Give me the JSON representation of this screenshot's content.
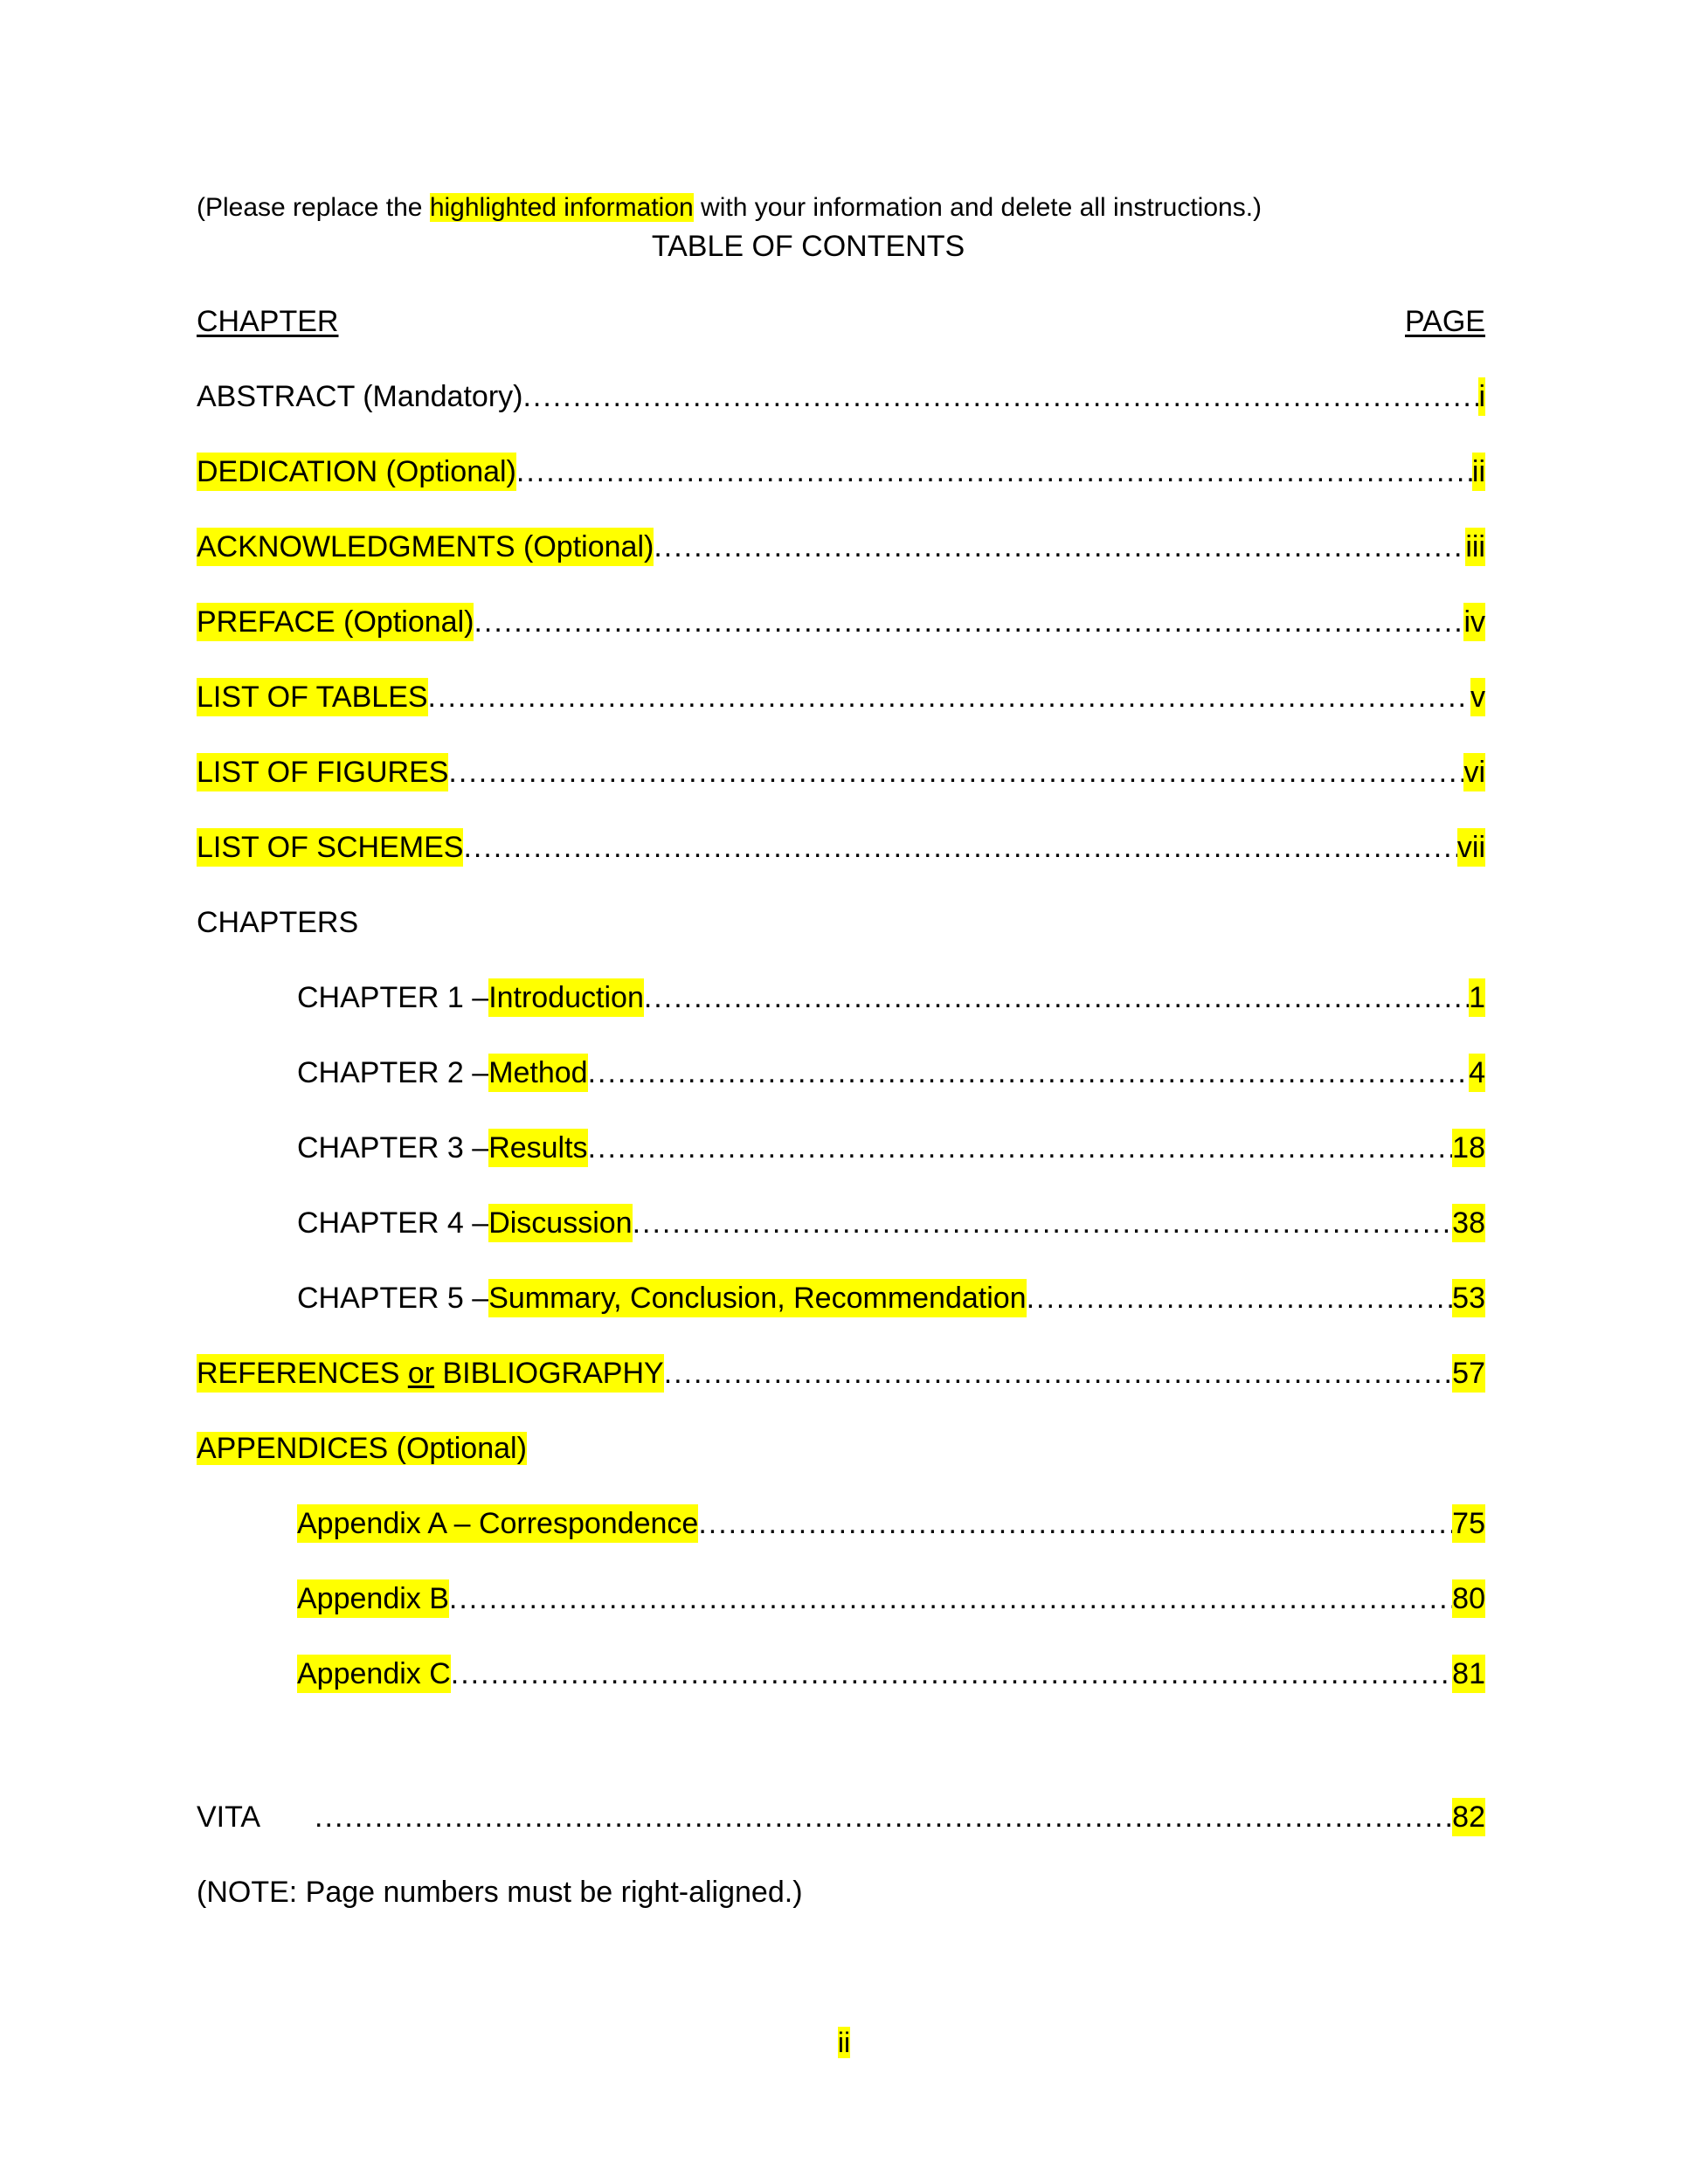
{
  "document": {
    "instruction_prefix": "(Please replace the ",
    "instruction_highlight": "highlighted information",
    "instruction_suffix": " with your information and delete all instructions.)",
    "title": "TABLE OF CONTENTS",
    "column_headers": {
      "left": "CHAPTER",
      "right": "PAGE"
    },
    "front_matter": [
      {
        "label": "ABSTRACT (Mandatory)",
        "page": "i",
        "label_highlighted": false,
        "page_highlighted": true
      },
      {
        "label": "DEDICATION (Optional)",
        "page": "ii",
        "label_highlighted": true,
        "page_highlighted": true
      },
      {
        "label": "ACKNOWLEDGMENTS (Optional)",
        "page": "iii",
        "label_highlighted": true,
        "page_highlighted": true
      },
      {
        "label": "PREFACE (Optional)",
        "page": "iv",
        "label_highlighted": true,
        "page_highlighted": true
      },
      {
        "label": "LIST OF TABLES",
        "page": "v",
        "label_highlighted": true,
        "page_highlighted": true
      },
      {
        "label": "LIST OF FIGURES",
        "page": "vi",
        "label_highlighted": true,
        "page_highlighted": true
      },
      {
        "label": "LIST OF SCHEMES",
        "page": "vii",
        "label_highlighted": true,
        "page_highlighted": true
      }
    ],
    "chapters_heading": "CHAPTERS",
    "chapters": [
      {
        "prefix": "CHAPTER 1 – ",
        "title": "Introduction",
        "page": "1"
      },
      {
        "prefix": "CHAPTER 2 – ",
        "title": "Method",
        "page": "4"
      },
      {
        "prefix": "CHAPTER 3 – ",
        "title": "Results",
        "page": "18"
      },
      {
        "prefix": "CHAPTER 4 – ",
        "title": "Discussion",
        "page": "38"
      },
      {
        "prefix": "CHAPTER 5 – ",
        "title": "Summary, Conclusion, Recommendation",
        "page": "53"
      }
    ],
    "references": {
      "part1": "REFERENCES ",
      "part_or": "or",
      "part2": " BIBLIOGRAPHY",
      "page": "57"
    },
    "appendices_heading": "APPENDICES (Optional)",
    "appendices": [
      {
        "label": "Appendix A – Correspondence",
        "page": "75"
      },
      {
        "label": "Appendix B ",
        "page": "80"
      },
      {
        "label": "Appendix C",
        "page": "81"
      }
    ],
    "vita": {
      "label": "VITA",
      "page": "82"
    },
    "bottom_note": "(NOTE:  Page numbers must be right-aligned.)",
    "footer_page_number": "ii",
    "colors": {
      "highlight": "#ffff00",
      "text": "#000000",
      "background": "#ffffff"
    }
  }
}
